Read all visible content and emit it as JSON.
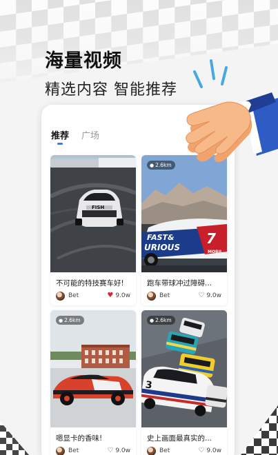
{
  "hero": {
    "headline": "海量视频",
    "subline": "精选内容 智能推荐"
  },
  "tabs": [
    {
      "label": "推荐",
      "active": true
    },
    {
      "label": "广场",
      "active": false
    }
  ],
  "cards": [
    {
      "title": "不可能的特技赛车好!",
      "author": "Bet",
      "likes": "9.0w",
      "liked": true,
      "distance": ""
    },
    {
      "title": "跑车带球冲过障碍...",
      "author": "Bet",
      "likes": "9.0w",
      "liked": false,
      "distance": "2.6km",
      "image_text": "FAST & FURIOUS 7"
    },
    {
      "title": "嗯显卡的香味!",
      "author": "Bet",
      "likes": "9.0w",
      "liked": false,
      "distance": "2.6km"
    },
    {
      "title": "史上画面最真实的...",
      "author": "Bet",
      "likes": "9.0w",
      "liked": false,
      "distance": "2.6km"
    }
  ],
  "colors": {
    "accent": "#2f80ed",
    "heart_filled": "#d2263b"
  },
  "icons": {
    "location": "location-pin-icon",
    "heart_filled": "heart-filled-icon",
    "heart_outline": "heart-outline-icon",
    "decoration": "clapping-hands-icon"
  }
}
